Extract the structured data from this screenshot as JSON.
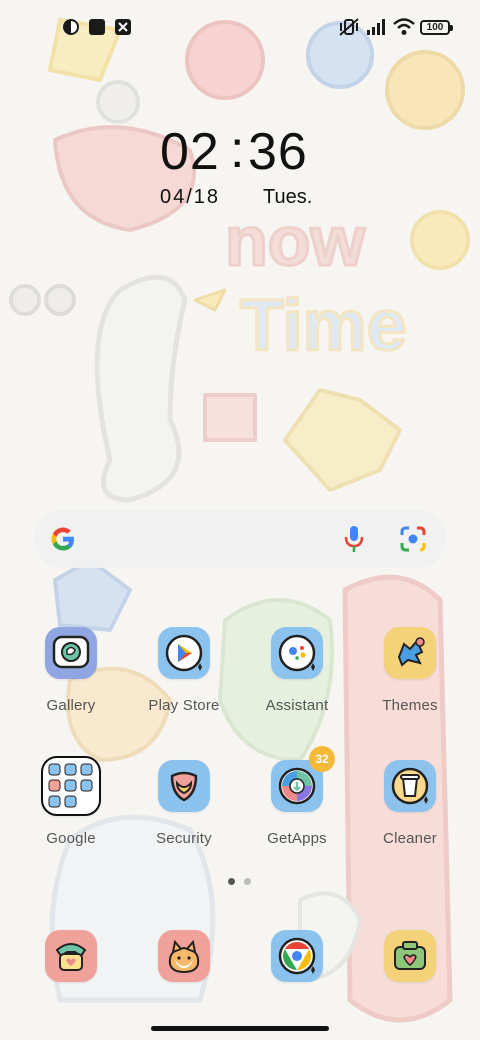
{
  "status_bar": {
    "left_icons": [
      "notification-dot-icon",
      "square-app-icon",
      "box-app-icon"
    ],
    "right_icons": [
      "vibrate-mute-icon",
      "signal-icon",
      "wifi-icon"
    ],
    "battery": "100"
  },
  "lockclock": {
    "hour": "02",
    "separator": ":",
    "minute": "36",
    "date": "04/18",
    "weekday": "Tues."
  },
  "search": {
    "icons": [
      "google-g-icon",
      "mic-icon",
      "lens-icon"
    ]
  },
  "apps": [
    {
      "label": "Gallery",
      "icon": "gallery-icon",
      "color": "#8fa6e3"
    },
    {
      "label": "Play Store",
      "icon": "play-store-icon",
      "color": "#8cc3ee"
    },
    {
      "label": "Assistant",
      "icon": "assistant-icon",
      "color": "#8cc3ee"
    },
    {
      "label": "Themes",
      "icon": "themes-icon",
      "color": "#f4d27a"
    },
    {
      "label": "Google",
      "icon": "google-folder-icon",
      "color": "#ffffff"
    },
    {
      "label": "Security",
      "icon": "security-icon",
      "color": "#8cc3ee"
    },
    {
      "label": "GetApps",
      "icon": "getapps-icon",
      "color": "#8cc3ee",
      "badge": "32"
    },
    {
      "label": "Cleaner",
      "icon": "cleaner-icon",
      "color": "#8cc3ee"
    }
  ],
  "dock": [
    {
      "icon": "phone-icon",
      "color": "#f0a19a"
    },
    {
      "icon": "messages-icon",
      "color": "#f0a19a"
    },
    {
      "icon": "chrome-icon",
      "color": "#8cc3ee"
    },
    {
      "icon": "camera-icon",
      "color": "#f4d27a"
    }
  ],
  "page_indicator": {
    "total": 2,
    "current": 1
  },
  "colors": {
    "badge": "#f5b93a",
    "dot_active": "#555555",
    "dot_inactive": "#bdbdbd"
  }
}
